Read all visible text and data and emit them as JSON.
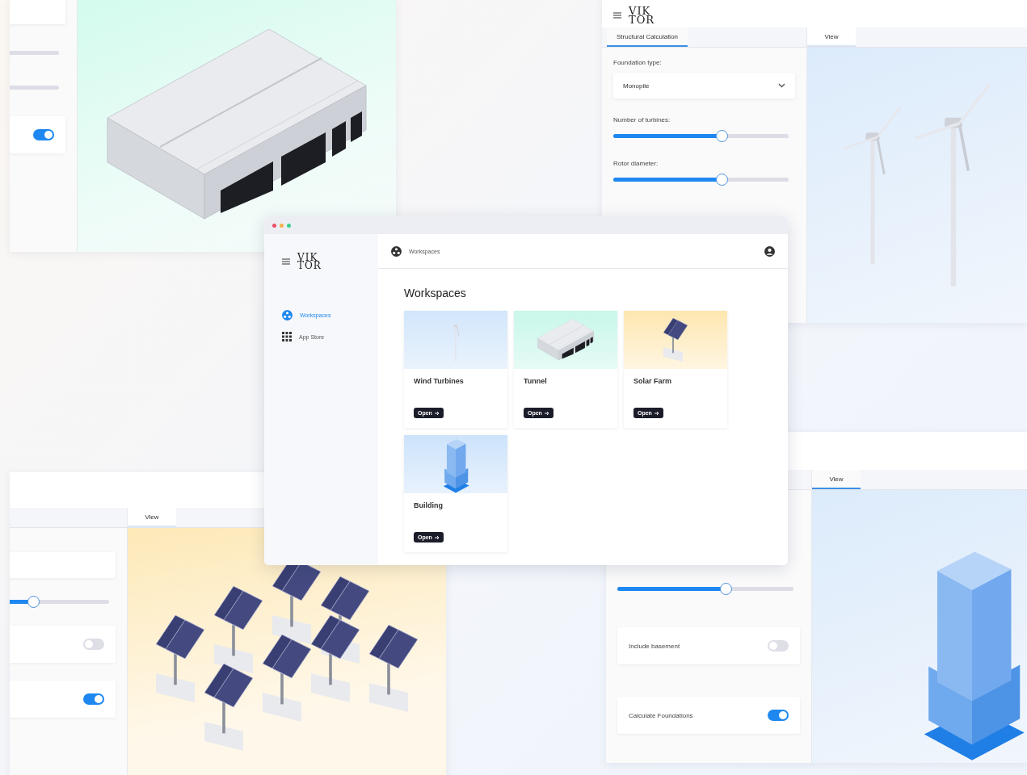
{
  "tunnel_window": {
    "controls": [
      {
        "kind": "select"
      },
      {
        "kind": "track"
      },
      {
        "kind": "track"
      },
      {
        "kind": "toggle",
        "on": true
      }
    ]
  },
  "wind_window": {
    "logo": {
      "top": "VIK",
      "bottom": "TOR"
    },
    "tabs": [
      {
        "label": "Structural Calculation",
        "selected": true
      },
      {
        "label": "View",
        "selected": false
      }
    ],
    "controls": [
      {
        "kind": "select",
        "label": "Foundation type:",
        "value": "Monopile"
      },
      {
        "kind": "slider",
        "label": "Number of turbines:",
        "level": 0.62
      },
      {
        "kind": "slider",
        "label": "Rotor diameter:",
        "level": 0.62
      }
    ]
  },
  "solar_window": {
    "tabs": [
      {
        "label": "View",
        "selected": false
      }
    ],
    "controls": [
      {
        "kind": "select"
      },
      {
        "kind": "slider",
        "level": 0.45
      },
      {
        "kind": "toggle",
        "on": false
      },
      {
        "kind": "toggle",
        "on": true
      }
    ]
  },
  "building_window": {
    "tabs": [
      {
        "label": "View",
        "selected": true
      }
    ],
    "controls": [
      {
        "kind": "slider",
        "level": 0.62
      },
      {
        "kind": "toggle",
        "label": "Include basement",
        "on": false
      },
      {
        "kind": "toggle",
        "label": "Calculate Foundations",
        "on": true
      }
    ]
  },
  "app_window": {
    "logo": {
      "top": "VIK",
      "bottom": "TOR"
    },
    "sidebar": [
      {
        "kind": "workspaces",
        "label": "Workspaces",
        "selected": true
      },
      {
        "kind": "apps",
        "label": "App Store",
        "selected": false
      }
    ],
    "breadcrumb": "Workspaces",
    "heading": "Workspaces",
    "cards": [
      {
        "kind": "turbine",
        "title": "Wind Turbines",
        "button": "Open"
      },
      {
        "kind": "tunnel",
        "title": "Tunnel",
        "button": "Open"
      },
      {
        "kind": "solar",
        "title": "Solar Farm",
        "button": "Open"
      },
      {
        "kind": "building",
        "title": "Building",
        "button": "Open"
      }
    ]
  }
}
